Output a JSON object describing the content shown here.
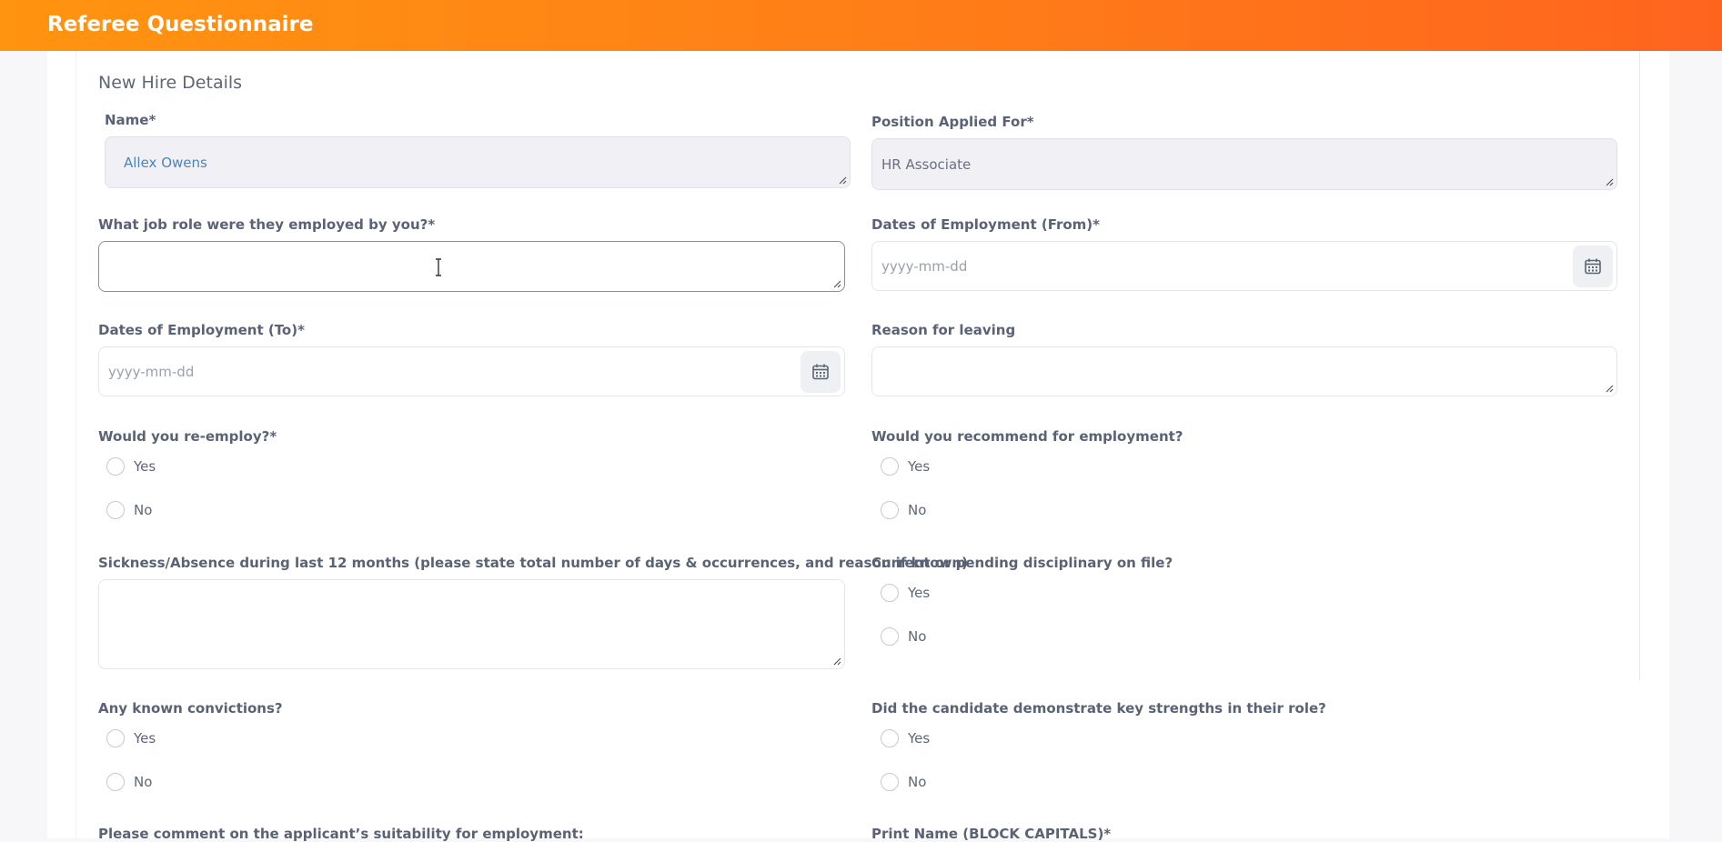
{
  "header": {
    "title": "Referee Questionnaire"
  },
  "section": {
    "title": "New Hire Details"
  },
  "fields": {
    "name": {
      "label": "Name*",
      "value": "Allex Owens"
    },
    "position": {
      "label": "Position Applied For*",
      "value": "HR Associate"
    },
    "job_role": {
      "label": "What job role were they employed by you?*",
      "value": ""
    },
    "date_from": {
      "label": "Dates of Employment (From)*",
      "placeholder": "yyyy-mm-dd"
    },
    "date_to": {
      "label": "Dates of Employment (To)*",
      "placeholder": "yyyy-mm-dd"
    },
    "reason": {
      "label": "Reason for leaving",
      "value": ""
    },
    "sickness": {
      "label": "Sickness/Absence during last 12 months (please state total number of days & occurrences, and reason if known)",
      "value": ""
    },
    "comment": {
      "label": "Please comment on the applicant’s suitability for employment:"
    },
    "print_name": {
      "label": "Print Name (BLOCK CAPITALS)*"
    }
  },
  "radios": {
    "reemploy": {
      "label": "Would you re-employ?*",
      "yes": "Yes",
      "no": "No"
    },
    "recommend": {
      "label": "Would you recommend for employment?",
      "yes": "Yes",
      "no": "No"
    },
    "disciplinary": {
      "label": "Current or pending disciplinary on file?",
      "yes": "Yes",
      "no": "No"
    },
    "convictions": {
      "label": "Any known convictions?",
      "yes": "Yes",
      "no": "No"
    },
    "strengths": {
      "label": "Did the candidate demonstrate key strengths in their role?",
      "yes": "Yes",
      "no": "No"
    }
  },
  "icons": {
    "calendar": "calendar-icon",
    "resize": "resize-handle-icon",
    "cursor": "text-cursor-icon"
  }
}
